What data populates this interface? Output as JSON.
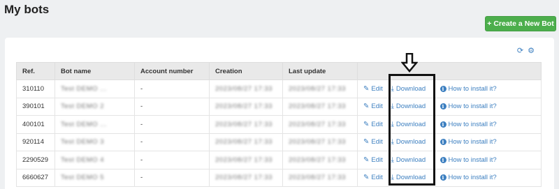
{
  "page": {
    "title": "My bots"
  },
  "toolbar": {
    "create_label": "+ Create a New Bot"
  },
  "panel": {
    "icons": [
      "refresh-icon",
      "gear-icon"
    ]
  },
  "table": {
    "headers": [
      "Ref.",
      "Bot name",
      "Account number",
      "Creation",
      "Last update",
      ""
    ],
    "rows": [
      {
        "ref": "310110",
        "name": "Test DEMO ...",
        "account": "-",
        "creation": "2023/08/27 17:33",
        "updated": "2023/08/27 17:33"
      },
      {
        "ref": "390101",
        "name": "Test DEMO 2",
        "account": "-",
        "creation": "2023/08/27 17:33",
        "updated": "2023/08/27 17:33"
      },
      {
        "ref": "400101",
        "name": "Test DEMO ...",
        "account": "-",
        "creation": "2023/08/27 17:33",
        "updated": "2023/08/27 17:33"
      },
      {
        "ref": "920114",
        "name": "Test DEMO 3",
        "account": "-",
        "creation": "2023/08/27 17:33",
        "updated": "2023/08/27 17:33"
      },
      {
        "ref": "2290529",
        "name": "Test DEMO 4",
        "account": "-",
        "creation": "2023/08/27 17:33",
        "updated": "2023/08/27 17:33"
      },
      {
        "ref": "6660627",
        "name": "Test DEMO 5",
        "account": "-",
        "creation": "2023/08/27 17:33",
        "updated": "2023/08/27 17:33"
      }
    ],
    "actions": {
      "edit": "Edit",
      "download": "Download",
      "install": "How to install it?"
    }
  },
  "colors": {
    "accent": "#3c7fc0",
    "create_button": "#4cae4c"
  }
}
